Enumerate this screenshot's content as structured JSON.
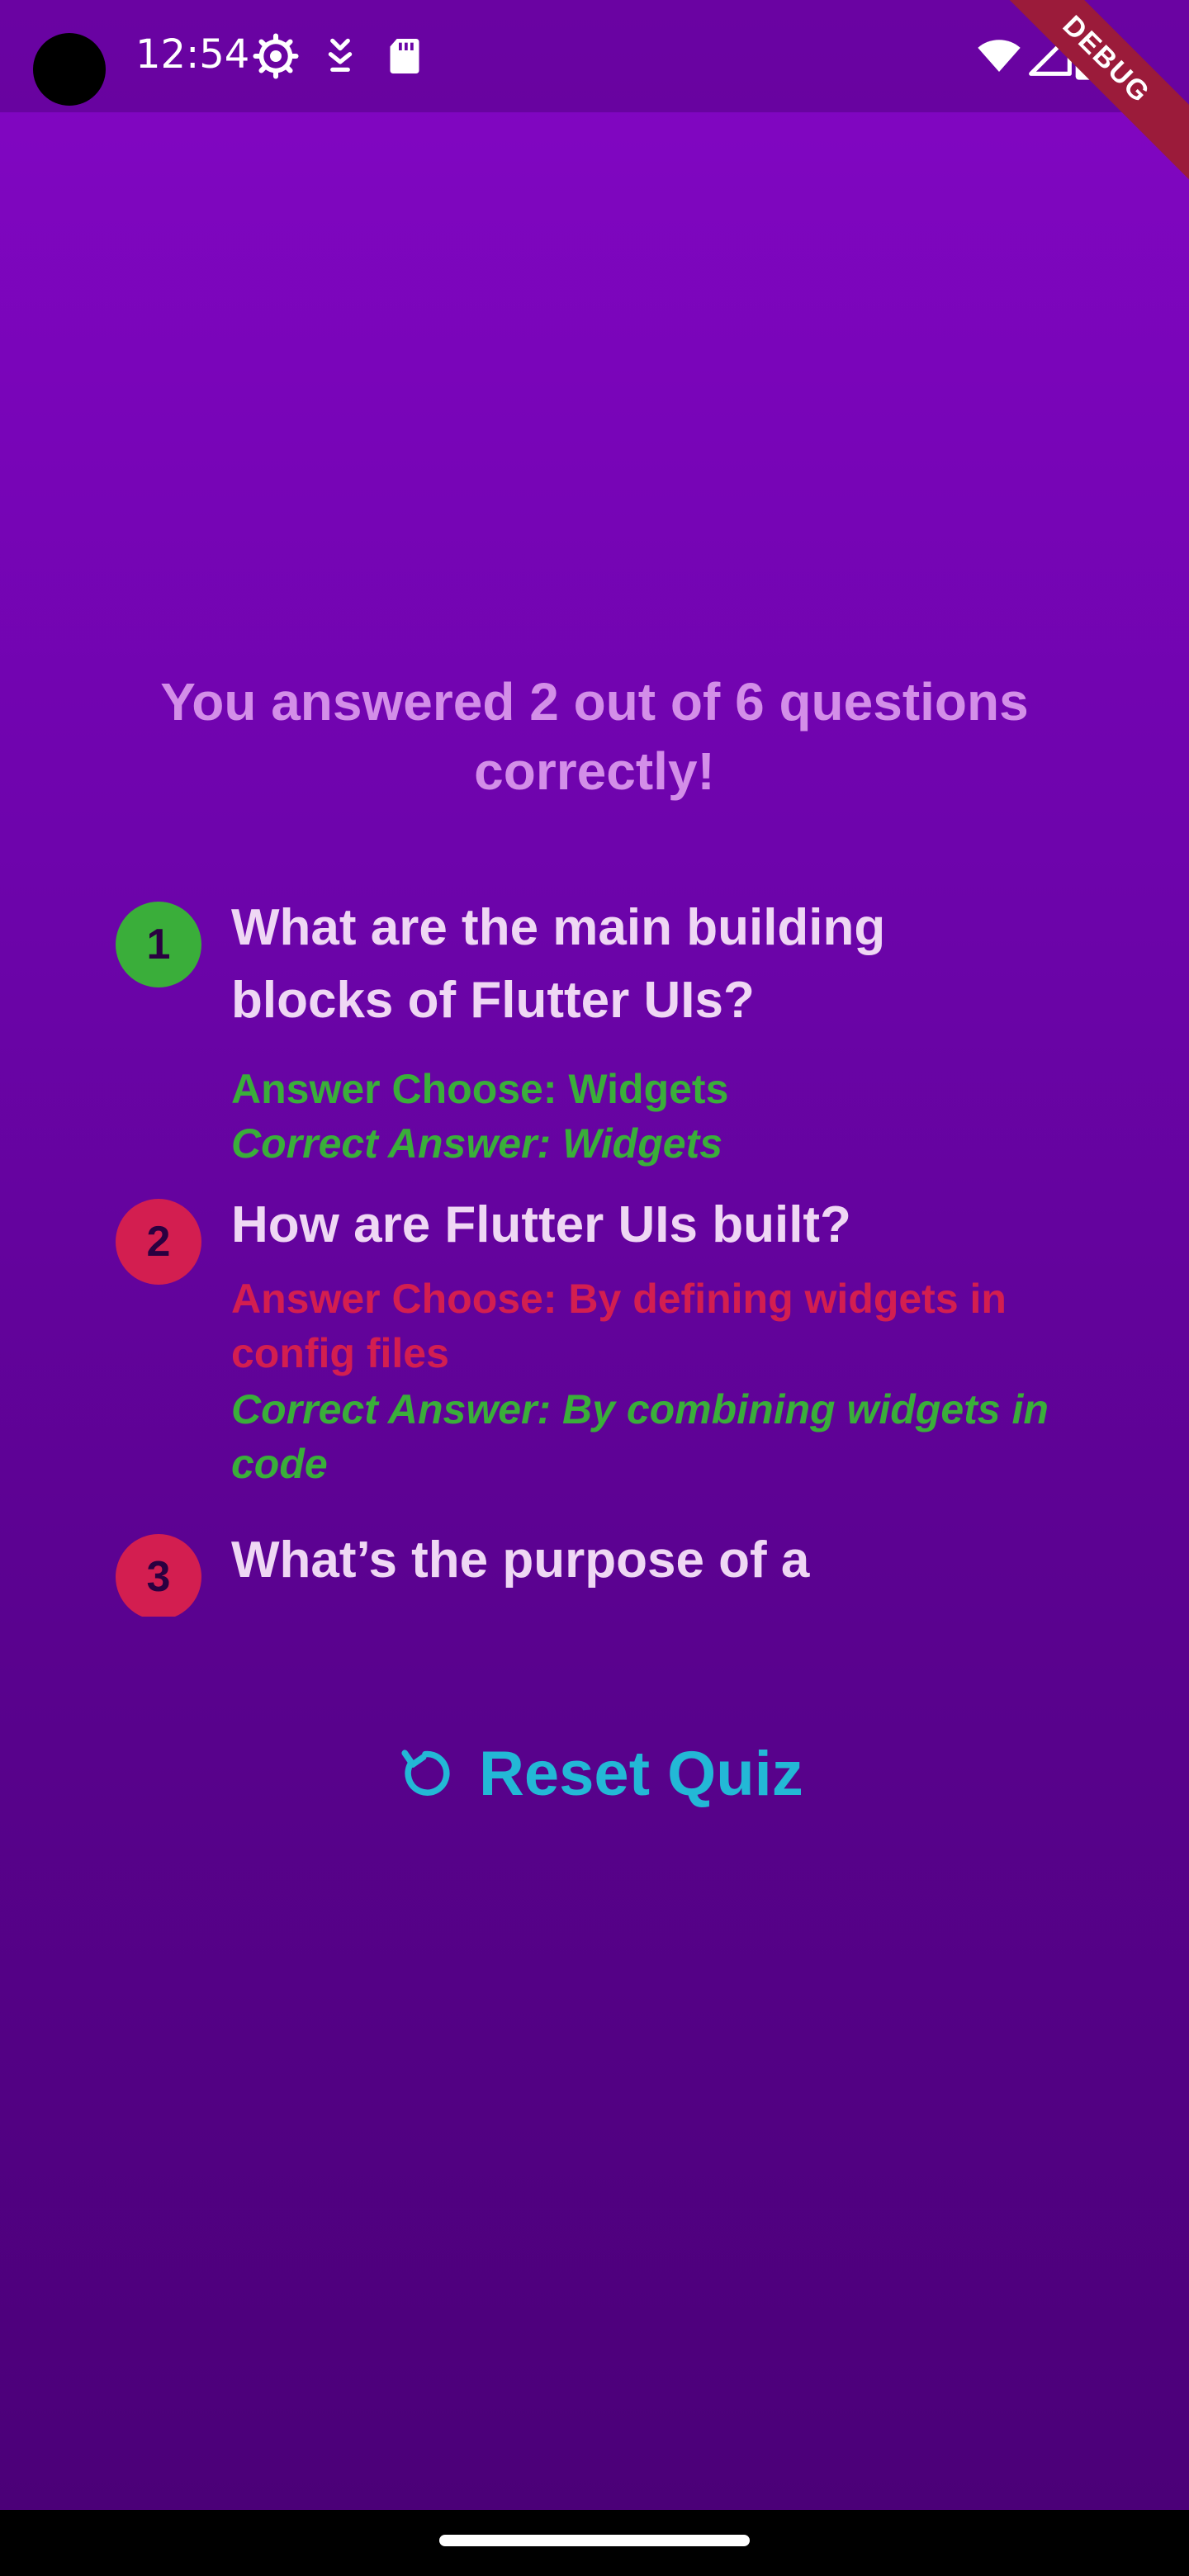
{
  "status_bar": {
    "time": "12:54",
    "icons_left": [
      "settings-icon",
      "download-icon",
      "sd-card-icon"
    ],
    "icons_right": [
      "wifi-icon",
      "signal-icon",
      "battery-icon"
    ],
    "debug_label": "DEBUG"
  },
  "summary": {
    "title": "You answered 2 out of 6 questions correctly!"
  },
  "results": [
    {
      "number": "1",
      "question": "What are the main building blocks of Flutter UIs?",
      "chosen": "Answer Choose: Widgets",
      "correct": "Correct Answer: Widgets",
      "is_correct": true
    },
    {
      "number": "2",
      "question": "How are Flutter UIs built?",
      "chosen": "Answer Choose: By defining widgets in config files",
      "correct": "Correct Answer: By combining widgets in code",
      "is_correct": false
    },
    {
      "number": "3",
      "question": "What’s the purpose of a",
      "chosen": "",
      "correct": "",
      "is_correct": false
    }
  ],
  "reset": {
    "label": "Reset Quiz",
    "icon": "refresh-icon"
  },
  "colors": {
    "correct": "#3aae3a",
    "wrong": "#d31e50",
    "accent": "#23b8d6",
    "title": "#d38ee8"
  }
}
